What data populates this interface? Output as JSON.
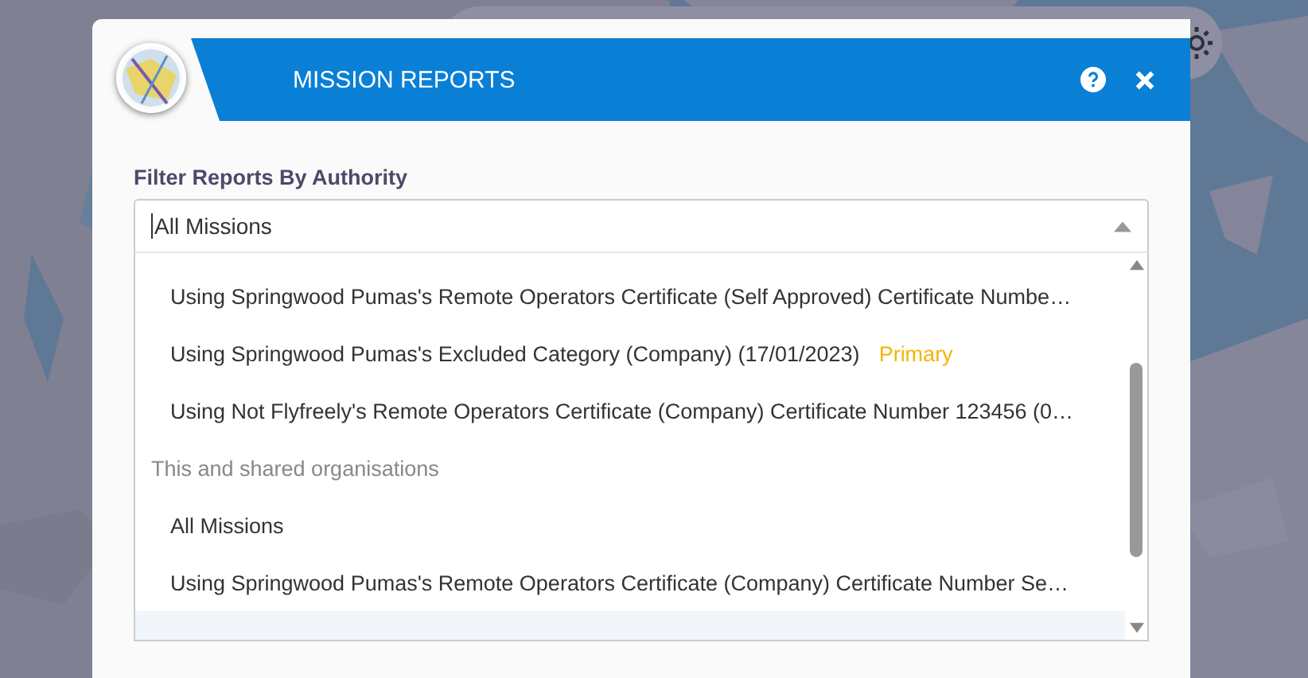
{
  "dialog": {
    "title": "MISSION REPORTS"
  },
  "filter": {
    "label": "Filter Reports By Authority",
    "value": "All Missions",
    "open": true
  },
  "dropdown": {
    "items": [
      {
        "kind": "option",
        "text": "Using Springwood Pumas's Remote Operators Certificate (Self Approved) Certificate Numbe…",
        "highlighted": false
      },
      {
        "kind": "option",
        "text": "Using Springwood Pumas's Excluded Category (Company) (17/01/2023)",
        "badge": "Primary",
        "highlighted": false
      },
      {
        "kind": "option",
        "text": "Using Not Flyfreely's Remote Operators Certificate (Company) Certificate Number 123456 (0…",
        "highlighted": false
      },
      {
        "kind": "group",
        "text": "This and shared organisations"
      },
      {
        "kind": "option",
        "text": "All Missions",
        "highlighted": false
      },
      {
        "kind": "option",
        "text": "Using Springwood Pumas's Remote Operators Certificate (Company) Certificate Number Se…",
        "highlighted": false
      },
      {
        "kind": "option",
        "highlighted": true
      }
    ]
  }
}
